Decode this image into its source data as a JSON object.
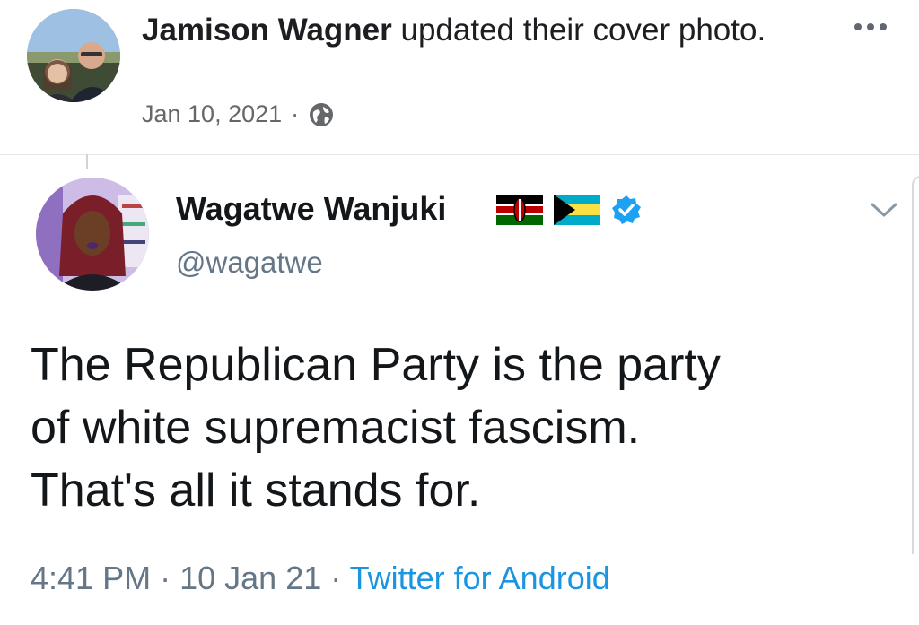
{
  "post": {
    "author": "Jamison Wagner",
    "action_text": " updated their cover photo.",
    "date": "Jan 10, 2021",
    "separator": "·"
  },
  "tweet": {
    "display_name": "Wagatwe Wanjuki",
    "handle": "@wagatwe",
    "text": "The Republican Party is the party\nof white supremacist fascism.\nThat's all it stands for.",
    "time": "4:41 PM",
    "sep": "·",
    "date": "10 Jan 21",
    "source": "Twitter for Android"
  },
  "icons": {
    "privacy": "globe-icon",
    "more": "more-options-icon",
    "verified": "verified-badge-icon",
    "flag_1": "kenya-flag-icon",
    "flag_2": "bahamas-flag-icon",
    "menu": "chevron-down-icon"
  },
  "colors": {
    "verified": "#1da1f2",
    "source_link": "#1b95e0",
    "muted_text": "#657786"
  }
}
